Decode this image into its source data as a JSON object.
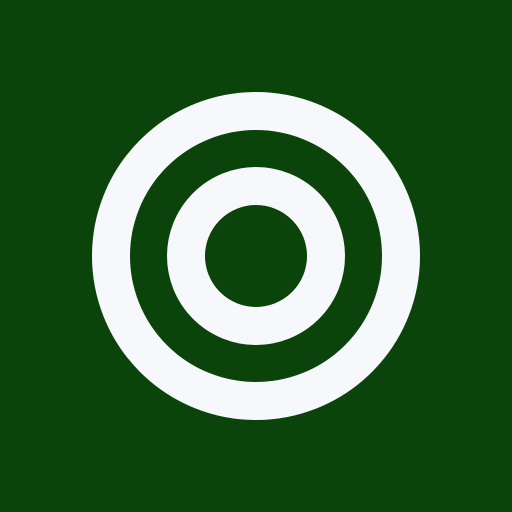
{
  "icon": {
    "name": "target-icon",
    "background_color": "#0b440b",
    "ring_color": "#f7f8fc"
  }
}
